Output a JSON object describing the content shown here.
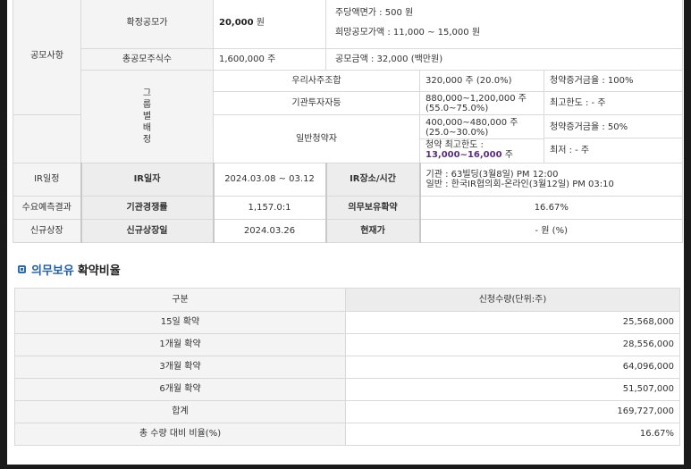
{
  "offering": {
    "category": "공모사항",
    "confirmed_price_label": "확정공모가",
    "confirmed_price_value": "20,000",
    "confirmed_price_unit": "원",
    "par_value": "주당액면가 :  500 원",
    "desired_price_range": "희망공모가액 :  11,000 ~ 15,000 원",
    "total_shares_label": "총공모주식수",
    "total_shares_value": "1,600,000 주",
    "offering_amount": "공모금액 :  32,000 (백만원)",
    "group_allocation_label": [
      "그",
      "룹",
      "별",
      "배",
      "정"
    ],
    "employee_label": "우리사주조합",
    "employee_value": "320,000 주  (20.0%)",
    "employee_deposit": "청약증거금율 : 100%",
    "institution_label": "기관투자자등",
    "institution_value_1": "880,000~1,200,000 주",
    "institution_value_2": "(55.0~75.0%)",
    "institution_limit": "최고한도 :  - 주",
    "retail_label": "일반청약자",
    "retail_value_1": "400,000~480,000 주",
    "retail_value_2": "(25.0~30.0%)",
    "retail_deposit": "청약증거금율 : 50%",
    "retail_max_label": "청약 최고한도 :",
    "retail_max_value": "13,000~16,000",
    "retail_max_unit": "주",
    "retail_min": "최저 :  - 주"
  },
  "ir": {
    "category": "IR일정",
    "date_label": "IR일자",
    "date_value": "2024.03.08 ~ 03.12",
    "place_label": "IR장소/시간",
    "place_line_1": "기관 : 63빌딩(3월8일) PM 12:00",
    "place_line_2": "일반 : 한국IR협의회-온라인(3월12일) PM 03:10"
  },
  "demand": {
    "category": "수요예측결과",
    "competition_label": "기관경쟁률",
    "competition_value": "1,157.0:1",
    "lockup_label": "의무보유확약",
    "lockup_value": "16.67%"
  },
  "listing": {
    "category": "신규상장",
    "date_label": "신규상장일",
    "date_value": "2024.03.26",
    "price_label": "현재가",
    "price_value": "- 원 (%)"
  },
  "section": {
    "title_highlight": "의무보유",
    "title_rest": "확약비율"
  },
  "ratio_table": {
    "headers": [
      "구분",
      "신청수량(단위:주)"
    ],
    "rows": [
      [
        "15일 확약",
        "25,568,000"
      ],
      [
        "1개월 확약",
        "28,556,000"
      ],
      [
        "3개월 확약",
        "64,096,000"
      ],
      [
        "6개월 확약",
        "51,507,000"
      ],
      [
        "합계",
        "169,727,000"
      ],
      [
        "총 수량 대비 비율(%)",
        "16.67%"
      ]
    ]
  },
  "colors": {
    "accent_blue": "#1f5fa8",
    "highlight_purple": "#5b2c7f"
  }
}
